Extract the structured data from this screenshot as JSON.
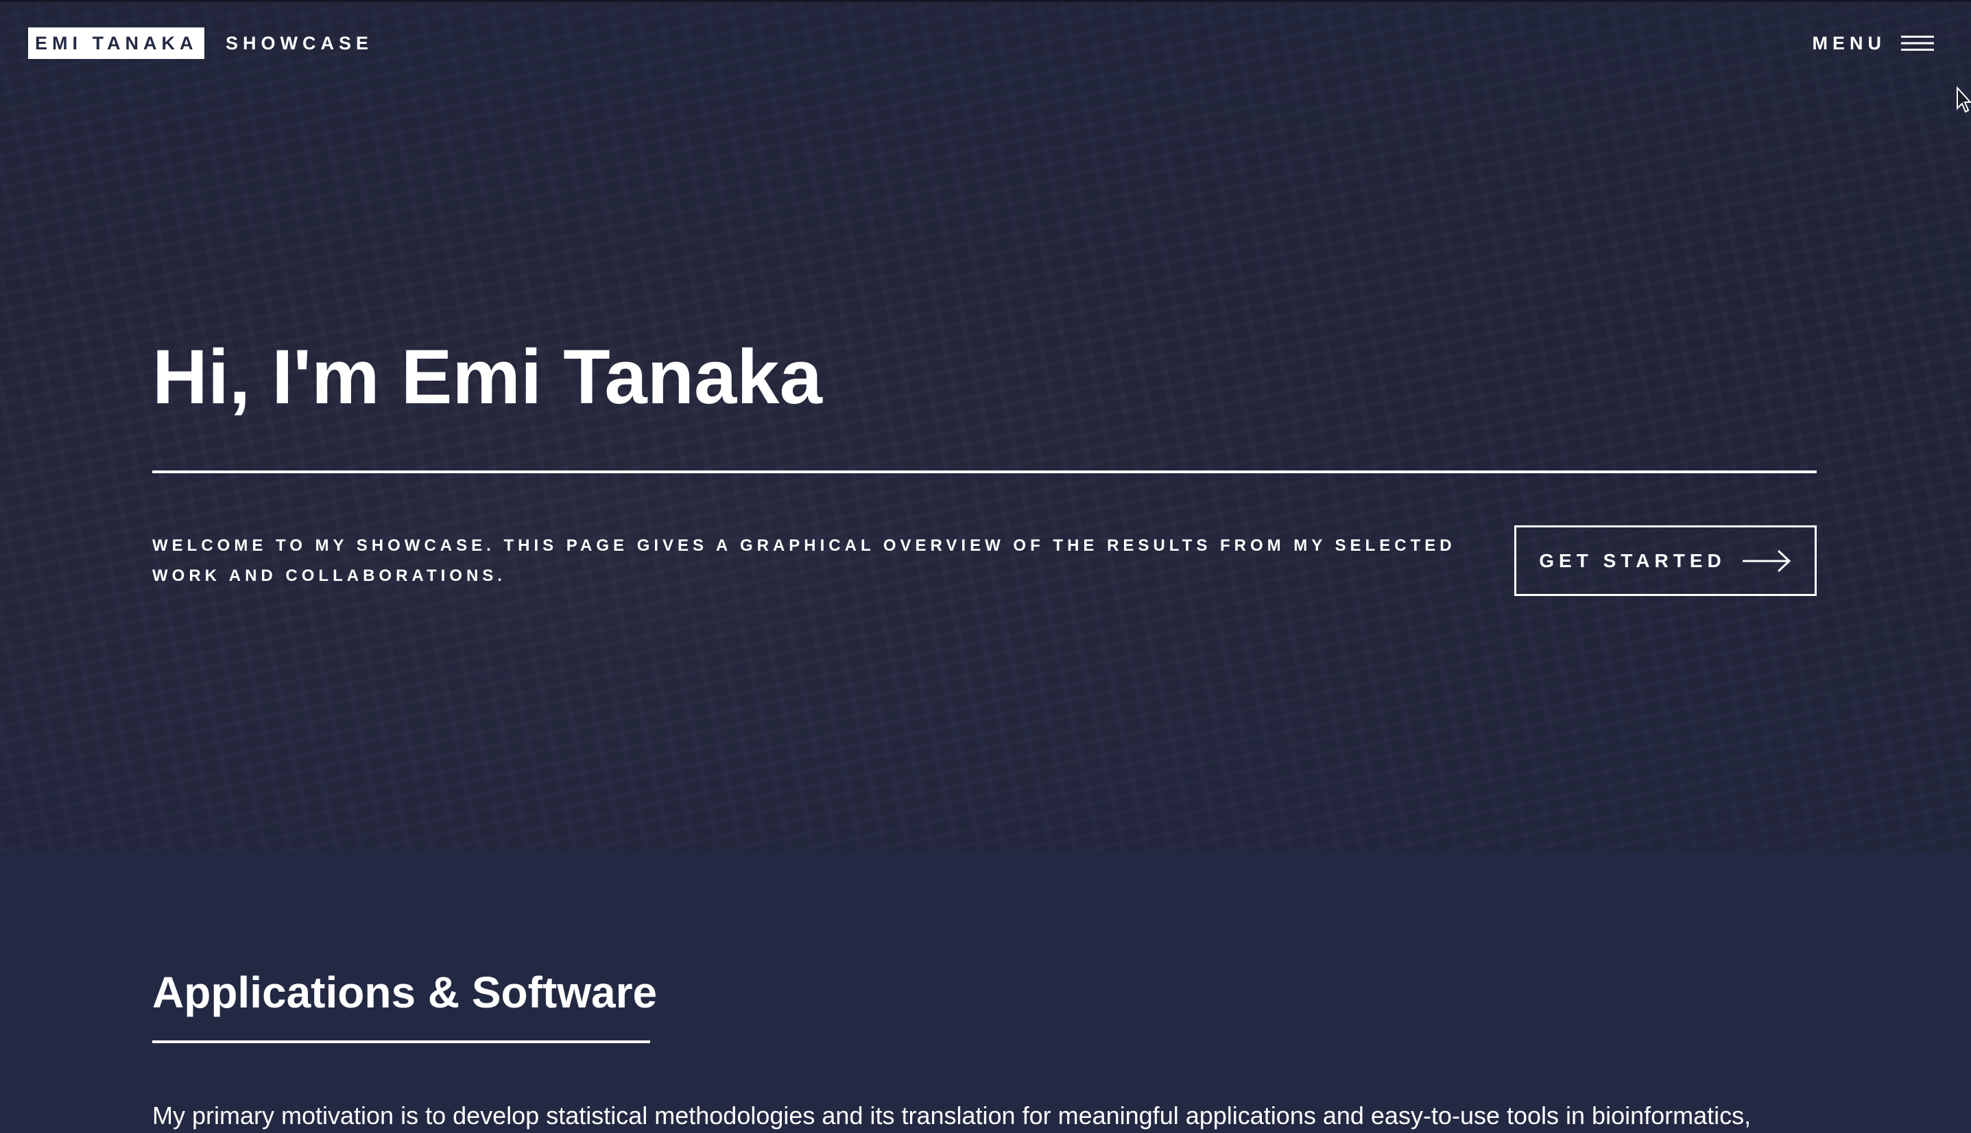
{
  "header": {
    "logo_name": "EMI TANAKA",
    "logo_sub": "SHOWCASE",
    "menu_label": "MENU",
    "menu_icon": "hamburger-icon"
  },
  "hero": {
    "title": "Hi, I'm Emi Tanaka",
    "description": "Welcome to my showcase. This page gives a graphical overview of the results from my selected work and collaborations.",
    "cta_label": "GET STARTED",
    "cta_icon": "arrow-right-icon"
  },
  "section": {
    "title": "Applications & Software",
    "body": "My primary motivation is to develop statistical methodologies and its translation for meaningful applications and easy-to-use tools in bioinformatics,"
  },
  "colors": {
    "background": "#242943",
    "text": "#ffffff"
  }
}
